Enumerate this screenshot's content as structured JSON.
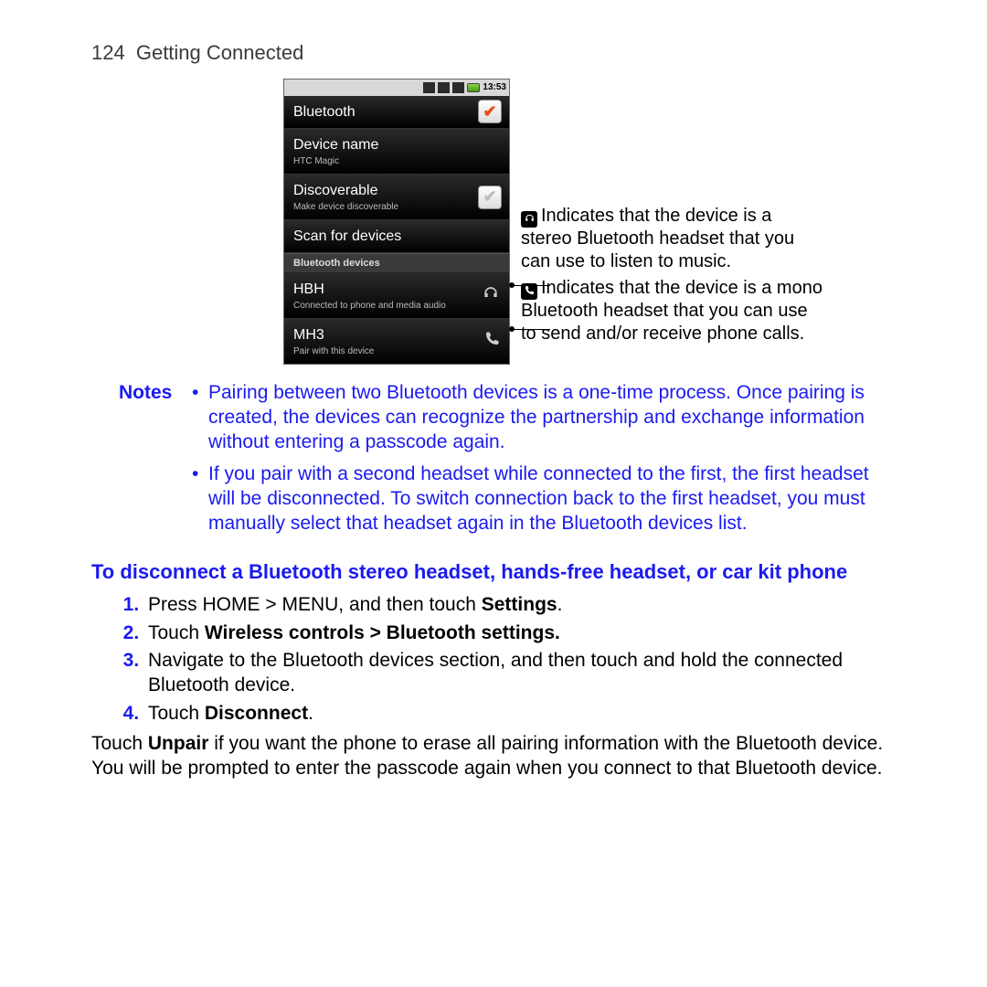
{
  "header": {
    "page_number": "124",
    "section": "Getting Connected"
  },
  "phone": {
    "status": {
      "time": "13:53"
    },
    "rows": {
      "bluetooth": {
        "title": "Bluetooth"
      },
      "device_name": {
        "title": "Device name",
        "sub": "HTC Magic"
      },
      "discoverable": {
        "title": "Discoverable",
        "sub": "Make device discoverable"
      },
      "scan": {
        "title": "Scan for devices"
      },
      "section": "Bluetooth devices",
      "dev1": {
        "title": "HBH",
        "sub": "Connected to phone and media audio"
      },
      "dev2": {
        "title": "MH3",
        "sub": "Pair with this device"
      }
    }
  },
  "callouts": {
    "c1": "Indicates that the device is a stereo Bluetooth headset that you can use to listen to music.",
    "c2": "Indicates that the device is a mono Bluetooth headset that you can use to send and/or receive phone calls."
  },
  "notes": {
    "label": "Notes",
    "items": [
      "Pairing between two Bluetooth devices is a one-time process. Once pairing is created, the devices can recognize the partnership and exchange information without entering a passcode again.",
      "If you pair with a second headset while connected to the first, the first headset will be disconnected. To switch connection back to the first headset, you must manually select that headset again in the Bluetooth devices list."
    ]
  },
  "heading": "To disconnect a Bluetooth stereo headset, hands-free headset, or car kit phone",
  "steps": {
    "s1a": "Press HOME > MENU, and then touch ",
    "s1b": "Settings",
    "s1c": ".",
    "s2a": "Touch ",
    "s2b": "Wireless controls > Bluetooth settings.",
    "s3": "Navigate to the Bluetooth devices section, and then touch and hold the connected Bluetooth device.",
    "s4a": "Touch ",
    "s4b": "Disconnect",
    "s4c": "."
  },
  "tail": {
    "a": "Touch ",
    "b": "Unpair",
    "c": " if you want the phone to erase all pairing information with the Bluetooth device. You will be prompted to enter the passcode again when you connect to that Bluetooth device."
  }
}
